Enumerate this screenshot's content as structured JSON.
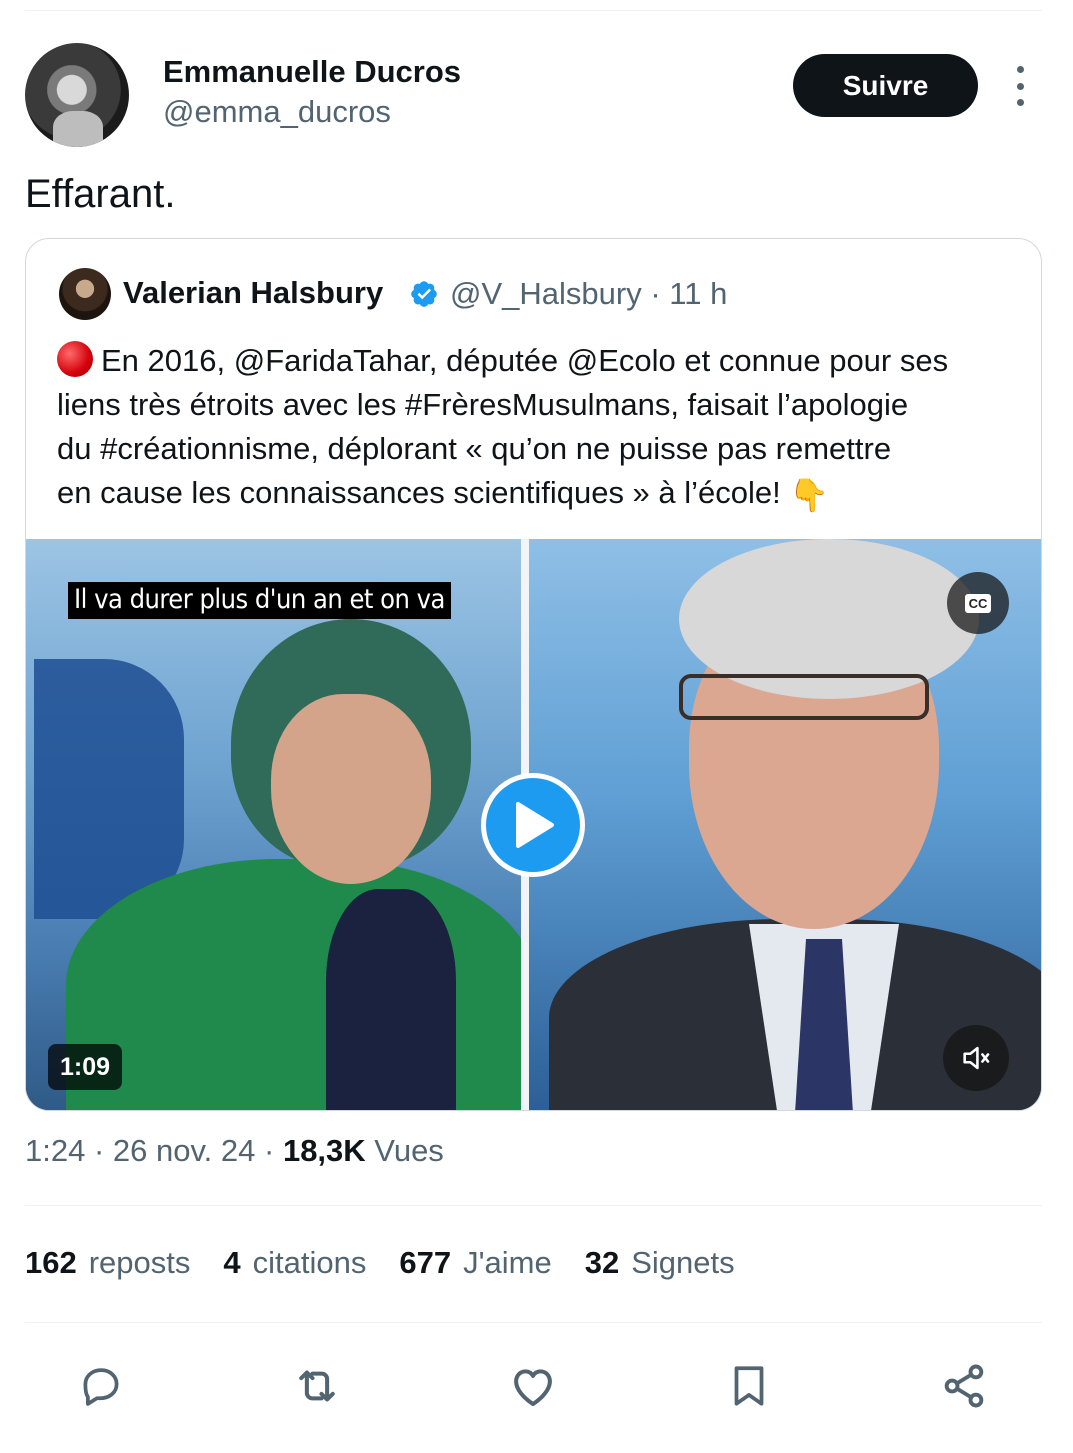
{
  "author": {
    "name": "Emmanuelle Ducros",
    "handle": "@emma_ducros",
    "follow_label": "Suivre"
  },
  "tweet": {
    "text": "Effarant."
  },
  "quote": {
    "name": "Valerian Halsbury",
    "handle": "@V_Halsbury",
    "time": "· 11 h",
    "line1": "En 2016, @FaridaTahar, députée @Ecolo et connue pour ses",
    "line2": "liens très étroits avec les #FrèresMusulmans, faisait l’apologie",
    "line3": "du #créationnisme, déplorant « qu’on ne puisse pas remettre",
    "line4": "en cause les connaissances scientifiques » à l’école!",
    "emoji": "👇",
    "video": {
      "caption": "Il va durer plus d'un an et on va",
      "cc_label": "CC",
      "duration": "1:09"
    }
  },
  "meta": {
    "time": "1:24",
    "sep1": " · ",
    "date": "26 nov. 24",
    "sep2": " · ",
    "views_count": "18,3K",
    "views_label": " Vues"
  },
  "stats": {
    "reposts_count": "162",
    "reposts_label": "reposts",
    "quotes_count": "4",
    "quotes_label": "citations",
    "likes_count": "677",
    "likes_label": "J'aime",
    "bookmarks_count": "32",
    "bookmarks_label": "Signets"
  },
  "colors": {
    "accent": "#1d9bf0",
    "text_primary": "#0f1419",
    "text_secondary": "#536471"
  },
  "icons": [
    "more-icon",
    "verified-icon",
    "red-circle-emoji",
    "cc-icon",
    "play-icon",
    "mute-icon",
    "reply-icon",
    "retweet-icon",
    "like-icon",
    "bookmark-icon",
    "share-icon"
  ]
}
